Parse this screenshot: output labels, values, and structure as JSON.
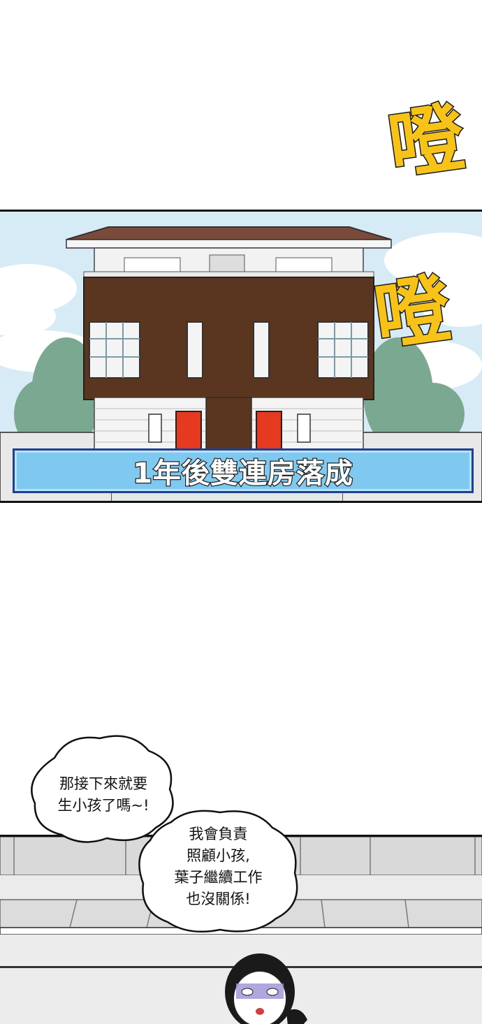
{
  "sound_effects": [
    {
      "text": "噔",
      "parts": [
        "口",
        "豆"
      ]
    },
    {
      "text": "噔",
      "parts": [
        "口",
        "豆"
      ]
    }
  ],
  "caption": "1年後雙連房落成",
  "bubbles": [
    {
      "lines": [
        "那接下來就要",
        "生小孩了嗎~!"
      ]
    },
    {
      "lines": [
        "我會負責",
        "照顧小孩,",
        "葉子繼續工作",
        "也沒關係!"
      ]
    }
  ],
  "colors": {
    "caption_fill": "#7fc8ef",
    "caption_border": "#1f3f8f",
    "sfx_fill": "#f7c318",
    "house_brown": "#5a3620",
    "door_red": "#e53a1f",
    "sky": "#cfe7f4"
  }
}
